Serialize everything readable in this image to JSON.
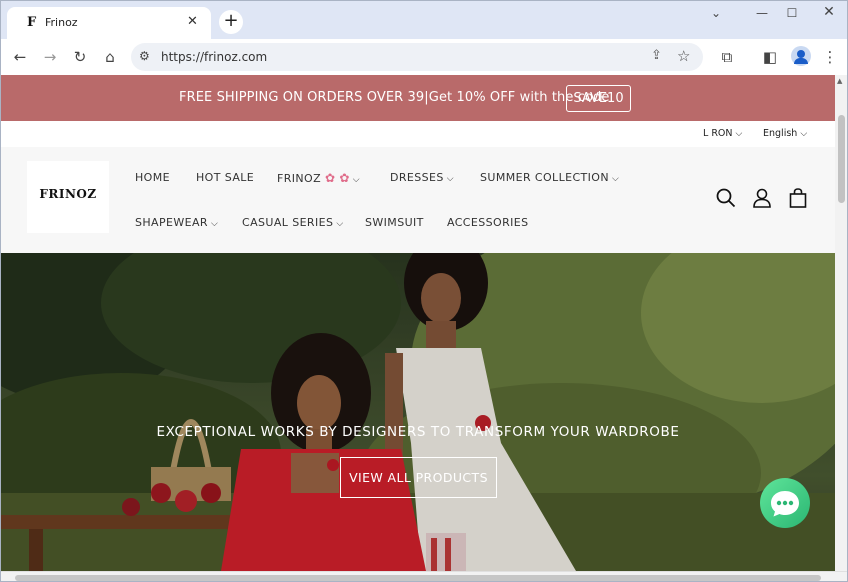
{
  "browser": {
    "tab_title": "Frinoz",
    "tab_favicon": "F",
    "new_tab": "+",
    "url": "https://frinoz.com"
  },
  "announcement": {
    "text": "FREE SHIPPING ON ORDERS OVER 39|Get 10% OFF with the code",
    "code": "SAVE10",
    "bg_color": "#b96a6a"
  },
  "utility": {
    "currency": "L RON",
    "language": "English"
  },
  "header": {
    "logo": "FRINOZ",
    "nav": [
      {
        "label": "HOME"
      },
      {
        "label": "HOT SALE"
      },
      {
        "label": "FRINOZ"
      },
      {
        "label": "DRESSES"
      },
      {
        "label": "SUMMER COLLECTION"
      },
      {
        "label": "SHAPEWEAR"
      },
      {
        "label": "CASUAL SERIES"
      },
      {
        "label": "SWIMSUIT"
      },
      {
        "label": "ACCESSORIES"
      }
    ]
  },
  "hero": {
    "tagline": "EXCEPTIONAL WORKS BY DESIGNERS TO TRANSFORM YOUR WARDROBE",
    "cta": "VIEW ALL PRODUCTS"
  },
  "icons": [
    "back-icon",
    "forward-icon",
    "reload-icon",
    "home-icon",
    "site-info-icon",
    "share-icon",
    "star-icon",
    "extensions-icon",
    "sidebar-icon",
    "profile-icon",
    "menu-icon",
    "search-icon",
    "account-icon",
    "cart-icon",
    "chat-icon",
    "flower-icon"
  ]
}
